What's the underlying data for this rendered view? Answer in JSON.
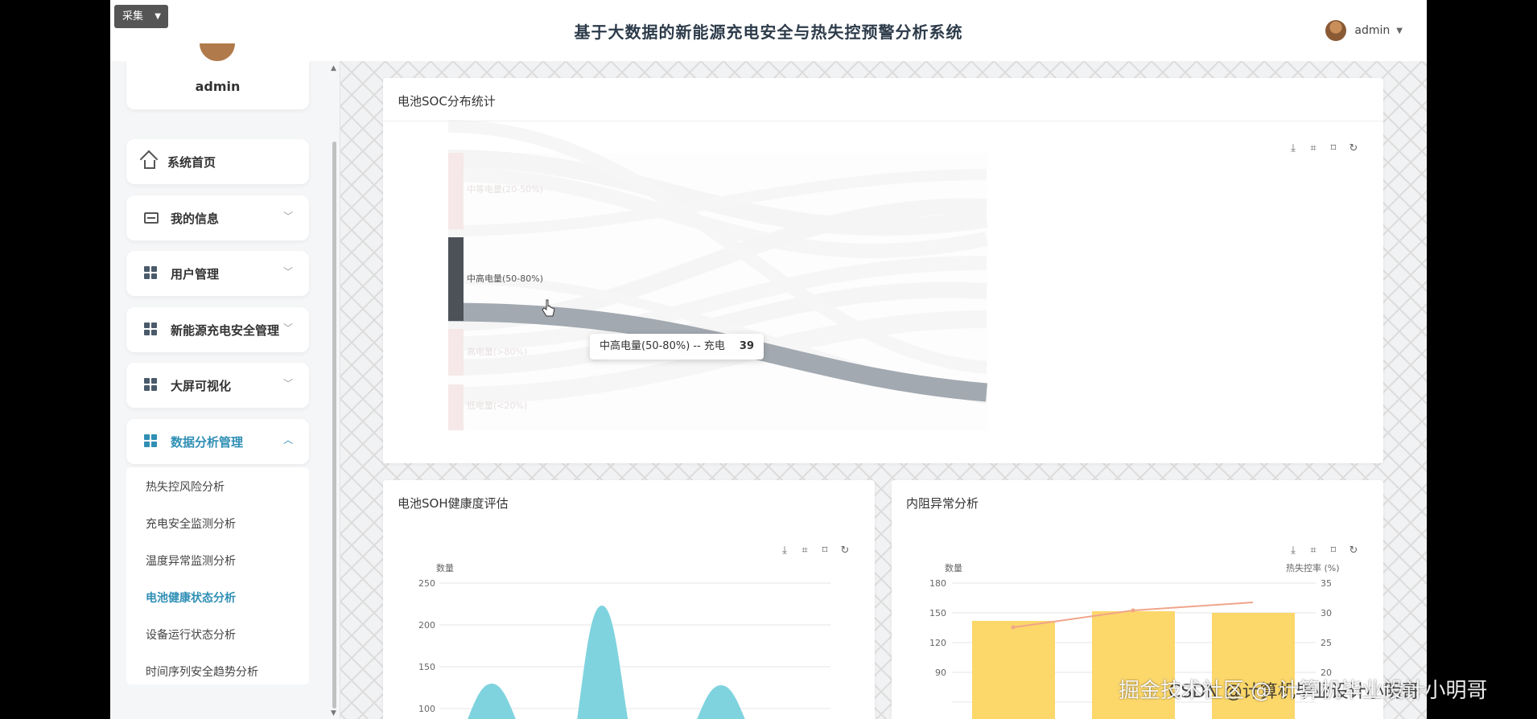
{
  "header": {
    "collect_label": "采集",
    "title": "基于大数据的新能源充电安全与热失控预警分析系统",
    "username": "admin"
  },
  "sidebar": {
    "profile_name": "admin",
    "items": [
      {
        "label": "系统首页",
        "icon": "home-icon"
      },
      {
        "label": "我的信息",
        "icon": "id-card-icon"
      },
      {
        "label": "用户管理",
        "icon": "grid-icon"
      },
      {
        "label": "新能源充电安全管理",
        "icon": "grid-icon"
      },
      {
        "label": "大屏可视化",
        "icon": "grid-icon"
      },
      {
        "label": "数据分析管理",
        "icon": "grid-icon",
        "expanded": true
      }
    ],
    "subitems": [
      {
        "label": "热失控风险分析"
      },
      {
        "label": "充电安全监测分析"
      },
      {
        "label": "温度异常监测分析"
      },
      {
        "label": "电池健康状态分析",
        "active": true
      },
      {
        "label": "设备运行状态分析"
      },
      {
        "label": "时间序列安全趋势分析"
      }
    ]
  },
  "panels": {
    "soc": {
      "title": "电池SOC分布统计",
      "tooltip_label": "中高电量(50-80%) -- 充电",
      "tooltip_value": "39"
    },
    "soh": {
      "title": "电池SOH健康度评估"
    },
    "resistance": {
      "title": "内阻异常分析"
    }
  },
  "chart_data": [
    {
      "type": "sankey",
      "title": "电池SOC分布统计",
      "nodes": [
        "中等电量(20-50%)",
        "中高电量(50-80%)",
        "高电量(>80%)",
        "低电量(<20%)",
        "充电"
      ],
      "highlighted_link": {
        "source": "中高电量(50-80%)",
        "target": "充电",
        "value": 39
      }
    },
    {
      "type": "area",
      "title": "电池SOH健康度评估",
      "ylabel": "数量",
      "ylim": [
        100,
        250
      ],
      "yticks": [
        250,
        200,
        150,
        100
      ],
      "peaks": [
        130,
        220,
        128
      ],
      "color": "#7fd3df"
    },
    {
      "type": "bar",
      "title": "内阻异常分析",
      "ylabel": "数量",
      "ylabel_right": "热失控率 (%)",
      "yticks": [
        180,
        150,
        120,
        90
      ],
      "yticks_right": [
        35,
        30,
        25,
        20
      ],
      "series": [
        {
          "name": "数量",
          "values": [
            142,
            152,
            151
          ],
          "color": "#fcd76a"
        },
        {
          "name": "热失控率 (%)",
          "values": [
            26.5,
            31,
            32.5
          ],
          "color": "#f0a58a"
        }
      ]
    }
  ],
  "watermark": "掘金技术社区 @ 计算机毕业设计小明哥",
  "watermark_back": "CSDN @计算机毕业设计小明哥"
}
